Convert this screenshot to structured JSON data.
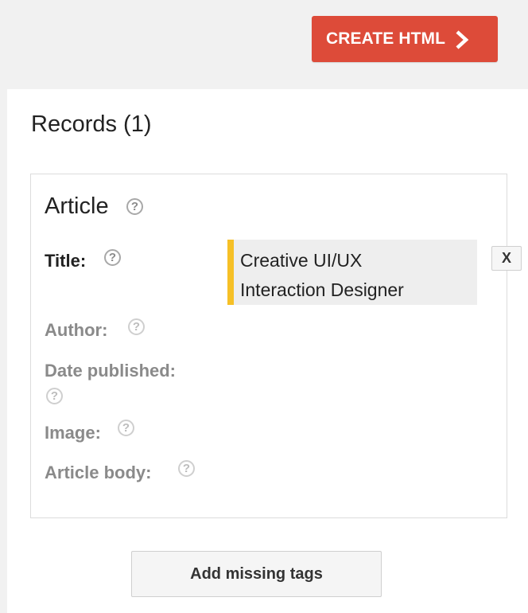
{
  "toolbar": {
    "create_label": "CREATE HTML",
    "create_icon": "chevron-right-icon",
    "accent": "#dd4b39"
  },
  "records": {
    "heading": "Records (1)",
    "items": [
      {
        "type": "Article",
        "fields": [
          {
            "label": "Title:",
            "value_lines": [
              "Creative UI/UX",
              "Interaction Designer"
            ],
            "status": "tagged"
          },
          {
            "label": "Author:",
            "status": "missing"
          },
          {
            "label": "Date published:",
            "status": "missing"
          },
          {
            "label": "Image:",
            "status": "missing"
          },
          {
            "label": "Article body:",
            "status": "missing"
          }
        ],
        "remove_label": "X",
        "highlight_color": "#f6c026"
      }
    ]
  },
  "actions": {
    "add_missing_label": "Add missing tags"
  },
  "icons": {
    "help": "help-circle-icon",
    "help_glyph": "?"
  }
}
